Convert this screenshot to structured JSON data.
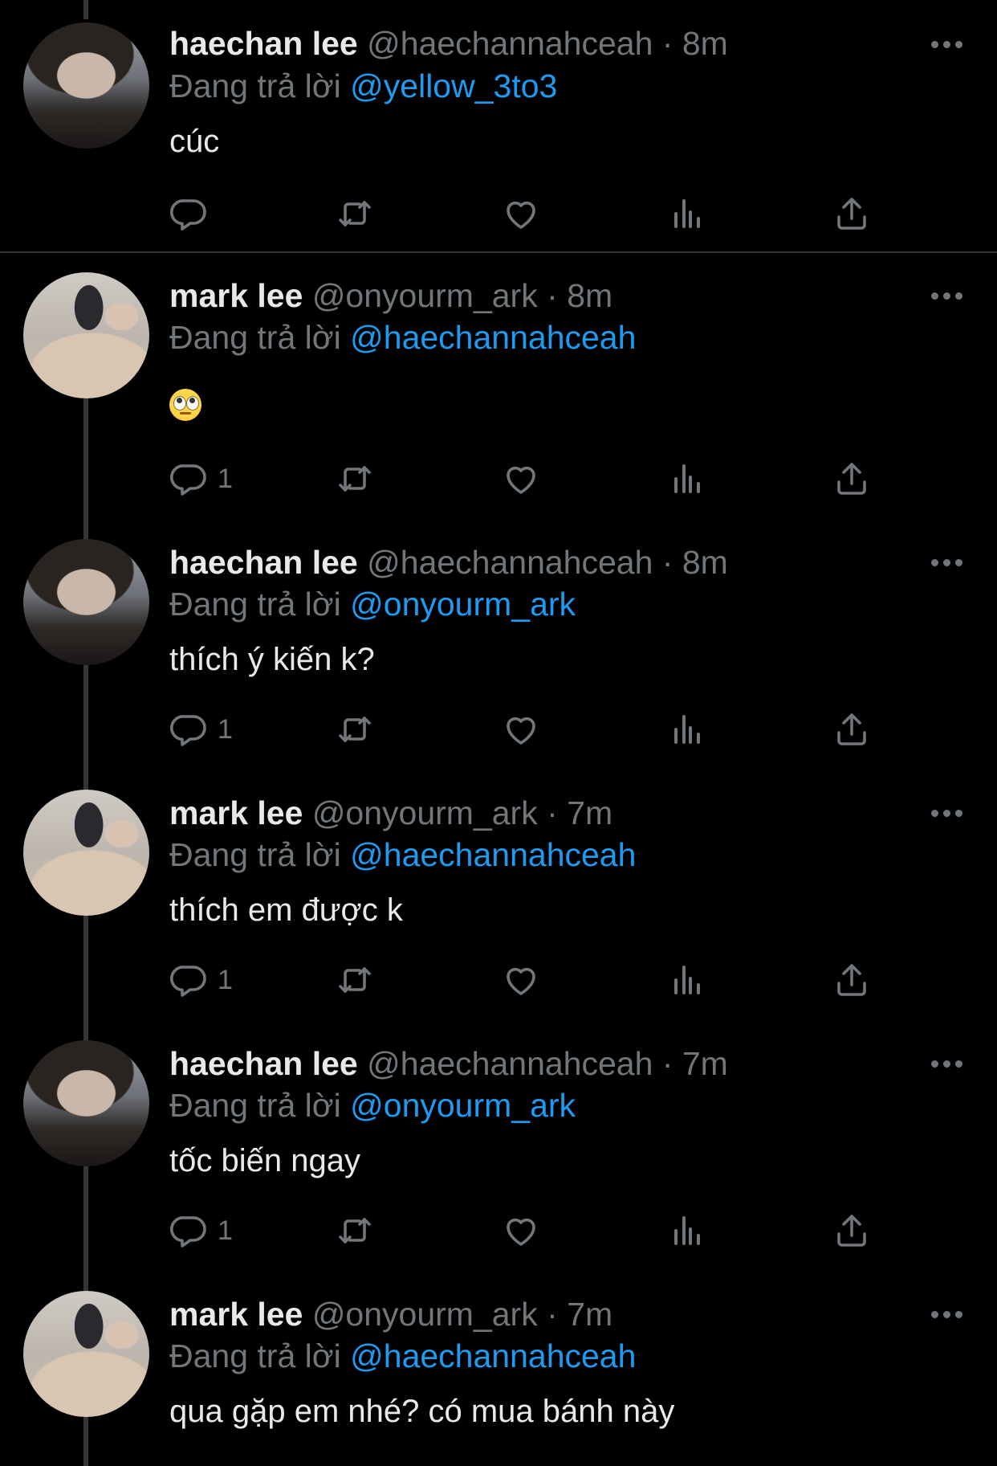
{
  "colors": {
    "background": "#000000",
    "text": "#e7e9ea",
    "muted": "#71767b",
    "accent": "#1d9bf0"
  },
  "icons": [
    "more-icon",
    "reply-icon",
    "retweet-icon",
    "like-icon",
    "views-icon",
    "share-icon"
  ],
  "reply_prefix": "Đang trả lời",
  "tweets": [
    {
      "name": "haechan lee",
      "handle": "@haechannahceah",
      "sep": "·",
      "time": "8m",
      "replying_to": "@yellow_3to3",
      "text": "cúc",
      "reply_count": ""
    },
    {
      "name": "mark lee",
      "handle": "@onyourm_ark",
      "sep": "·",
      "time": "8m",
      "replying_to": "@haechannahceah",
      "text": "",
      "emoji": "face-with-rolling-eyes",
      "reply_count": "1"
    },
    {
      "name": "haechan lee",
      "handle": "@haechannahceah",
      "sep": "·",
      "time": "8m",
      "replying_to": "@onyourm_ark",
      "text": "thích ý kiến k?",
      "reply_count": "1"
    },
    {
      "name": "mark lee",
      "handle": "@onyourm_ark",
      "sep": "·",
      "time": "7m",
      "replying_to": "@haechannahceah",
      "text": "thích em được k",
      "reply_count": "1"
    },
    {
      "name": "haechan lee",
      "handle": "@haechannahceah",
      "sep": "·",
      "time": "7m",
      "replying_to": "@onyourm_ark",
      "text": "tốc biến ngay",
      "reply_count": "1"
    },
    {
      "name": "mark lee",
      "handle": "@onyourm_ark",
      "sep": "·",
      "time": "7m",
      "replying_to": "@haechannahceah",
      "text": "qua gặp em nhé? có mua bánh này",
      "reply_count": ""
    }
  ]
}
